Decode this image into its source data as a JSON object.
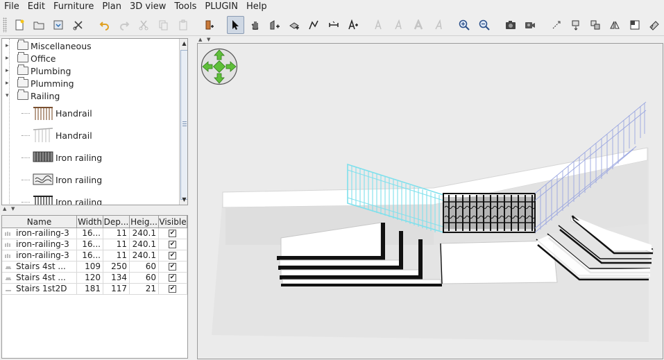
{
  "menu": [
    "File",
    "Edit",
    "Furniture",
    "Plan",
    "3D view",
    "Tools",
    "PLUGIN",
    "Help"
  ],
  "toolbar": {
    "buttons": [
      "new-home",
      "open",
      "save",
      "preferences",
      "undo",
      "redo",
      "cut",
      "copy",
      "paste",
      "add-furniture",
      "select-mode",
      "pan-mode",
      "create-walls",
      "create-rooms",
      "create-polylines",
      "create-dimensions",
      "add-text",
      "text-style-bold-a",
      "text-style-italic-a",
      "text-style-bold",
      "text-style-italic",
      "zoom-in",
      "zoom-out",
      "create-photo",
      "create-video",
      "flip-horizontally",
      "flip-vertically",
      "group",
      "mirror",
      "view-from-top",
      "view-virtual-visit"
    ]
  },
  "catalog": {
    "categories": [
      "Miscellaneous",
      "Office",
      "Plumbing",
      "Plumming",
      "Railing"
    ],
    "items": [
      "Handrail",
      "Handrail",
      "Iron railing",
      "Iron railing",
      "Iron railing"
    ]
  },
  "table": {
    "columns": [
      "Name",
      "Width",
      "Dep...",
      "Heig...",
      "Visible"
    ],
    "rows": [
      {
        "name": "iron-railing-3",
        "width": "16...",
        "depth": "11",
        "height": "240.1",
        "visible": "✔"
      },
      {
        "name": "iron-railing-3",
        "width": "16...",
        "depth": "11",
        "height": "240.1",
        "visible": "✔"
      },
      {
        "name": "iron-railing-3",
        "width": "16...",
        "depth": "11",
        "height": "240.1",
        "visible": "✔"
      },
      {
        "name": "Stairs 4st ...",
        "width": "109",
        "depth": "250",
        "height": "60",
        "visible": "✔"
      },
      {
        "name": "Stairs 4st ...",
        "width": "120",
        "depth": "134",
        "height": "60",
        "visible": "✔"
      },
      {
        "name": "Stairs 1st2D",
        "width": "181",
        "depth": "117",
        "height": "21",
        "visible": "✔"
      }
    ]
  },
  "colors": {
    "selected_railing": "#7fe0ec",
    "wire_railing": "#9aa6e0",
    "black_railing": "#1a1a1a",
    "view_bg": "#ebebeb"
  }
}
